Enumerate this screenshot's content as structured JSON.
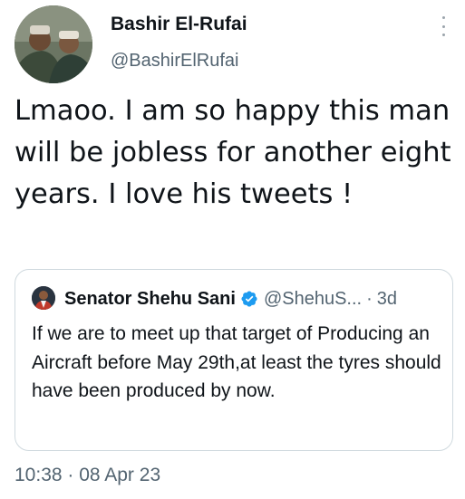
{
  "tweet": {
    "author": {
      "display_name": "Bashir El-Rufai",
      "handle": "@BashirElRufai",
      "avatar_icon": "profile-photo"
    },
    "more_icon": "more-vertical-icon",
    "text": "Lmaoo. I am so happy this man will be jobless for another eight years. I love his tweets !",
    "timestamp": "10:38 · 08 Apr 23"
  },
  "quoted_tweet": {
    "author": {
      "display_name": "Senator Shehu Sani",
      "handle": "@ShehuS...",
      "verified_icon": "verified-badge-icon",
      "avatar_icon": "profile-photo"
    },
    "separator": "·",
    "time": "3d",
    "text": "If we are to meet up that target of Producing an Aircraft before May 29th,at least the tyres should have been produced by now."
  },
  "colors": {
    "primary_text": "#0f1419",
    "secondary_text": "#536471",
    "border": "#cfd9de",
    "verified_blue": "#1d9bf0"
  }
}
